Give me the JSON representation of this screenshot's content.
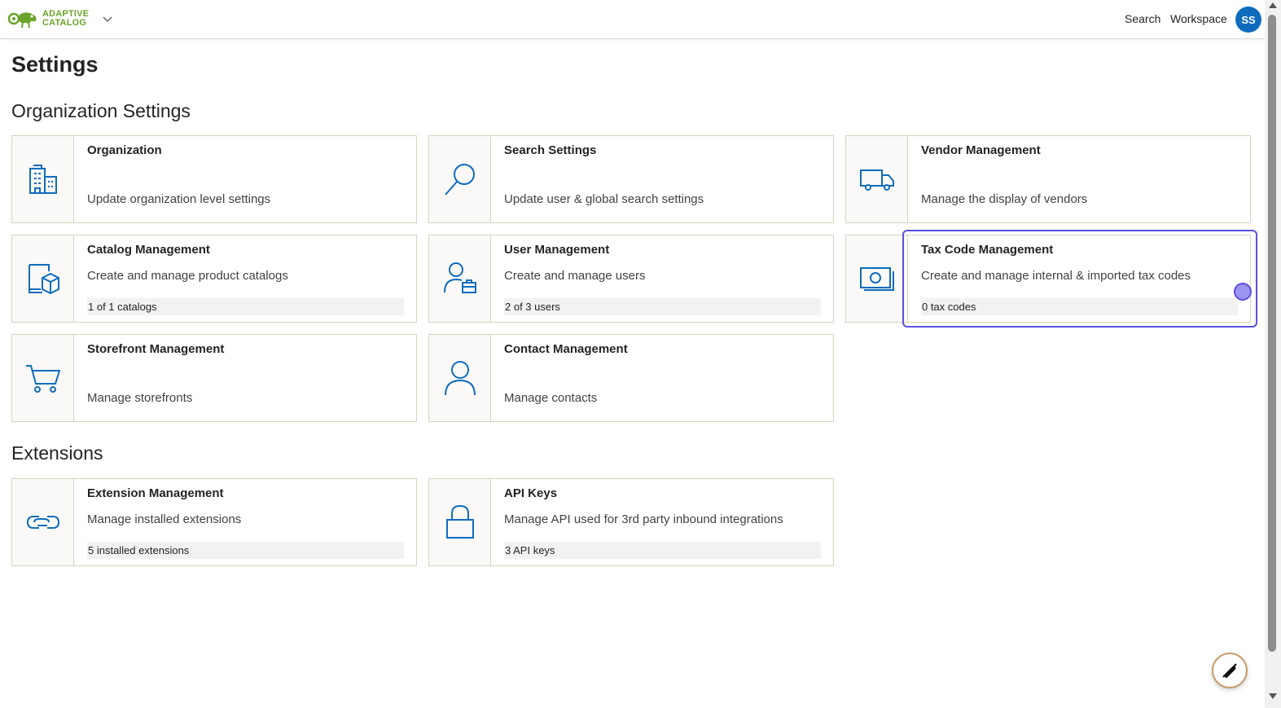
{
  "header": {
    "logo_line1": "ADAPTIVE",
    "logo_line2": "CATALOG",
    "search_label": "Search",
    "workspace_label": "Workspace",
    "avatar_initials": "SS"
  },
  "page": {
    "title": "Settings"
  },
  "sections": {
    "org": {
      "title": "Organization Settings",
      "cards": {
        "organization": {
          "title": "Organization",
          "desc": "Update organization level settings",
          "icon": "building-icon"
        },
        "search": {
          "title": "Search Settings",
          "desc": "Update user & global search settings",
          "icon": "search-icon"
        },
        "vendor": {
          "title": "Vendor Management",
          "desc": "Manage the display of vendors",
          "icon": "truck-icon"
        },
        "catalog": {
          "title": "Catalog Management",
          "desc": "Create and manage product catalogs",
          "count": "1 of 1 catalogs",
          "icon": "catalog-box-icon"
        },
        "user": {
          "title": "User Management",
          "desc": "Create and manage users",
          "count": "2 of 3 users",
          "icon": "user-briefcase-icon"
        },
        "tax": {
          "title": "Tax Code Management",
          "desc": "Create and manage internal & imported tax codes",
          "count": "0 tax codes",
          "icon": "money-icon"
        },
        "storefront": {
          "title": "Storefront Management",
          "desc": "Manage storefronts",
          "icon": "cart-icon"
        },
        "contact": {
          "title": "Contact Management",
          "desc": "Manage contacts",
          "icon": "person-icon"
        }
      }
    },
    "ext": {
      "title": "Extensions",
      "cards": {
        "extension": {
          "title": "Extension Management",
          "desc": "Manage installed extensions",
          "count": "5 installed extensions",
          "icon": "link-icon"
        },
        "api": {
          "title": "API Keys",
          "desc": "Manage API used for 3rd party inbound integrations",
          "count": "3 API keys",
          "icon": "lock-icon"
        }
      }
    }
  },
  "colors": {
    "accent": "#0f6cbd",
    "icon_blue": "#0f6cbd",
    "brand_green": "#6aa42a",
    "focus": "#5b4fe0"
  }
}
